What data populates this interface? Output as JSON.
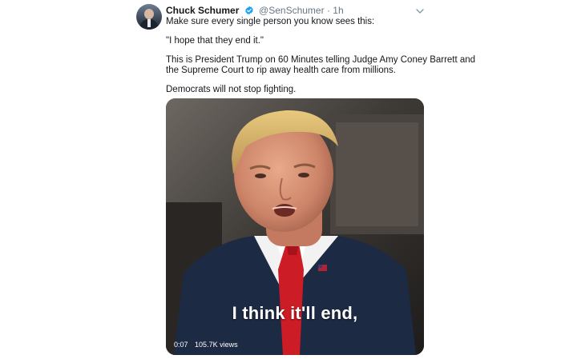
{
  "tweet": {
    "author_name": "Chuck Schumer",
    "handle": "@SenSchumer",
    "separator": "·",
    "timestamp": "1h",
    "lines": [
      "Make sure every single person you know sees this:",
      "\"I hope that they end it.\"",
      "This is President Trump on 60 Minutes telling Judge Amy Coney Barrett and",
      "the Supreme Court to rip away health care from millions.",
      "Democrats will not stop fighting."
    ]
  },
  "media": {
    "caption": "I think it'll end,",
    "elapsed": "0:07",
    "views": "105.7K views"
  },
  "colors": {
    "verified": "#1da1f2",
    "secondary": "#657786"
  },
  "icons": {
    "verified": "verified-badge-icon",
    "menu": "chevron-down-icon"
  }
}
